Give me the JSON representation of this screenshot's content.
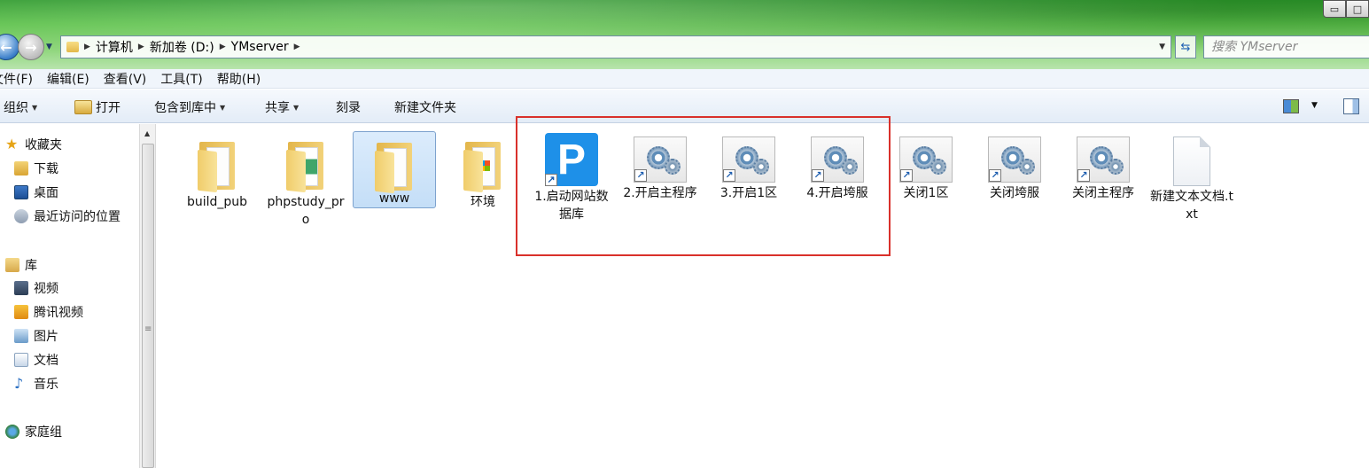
{
  "window": {
    "minimize_icon": "▭",
    "maximize_icon": "□"
  },
  "addressbar": {
    "crumbs": [
      "计算机",
      "新加卷 (D:)",
      "YMserver"
    ],
    "search_placeholder": "搜索 YMserver"
  },
  "menu": {
    "items": [
      "文件(F)",
      "编辑(E)",
      "查看(V)",
      "工具(T)",
      "帮助(H)"
    ]
  },
  "toolbar": {
    "organize": "组织",
    "open": "打开",
    "include_library": "包含到库中",
    "share": "共享",
    "burn": "刻录",
    "new_folder": "新建文件夹"
  },
  "navpane": {
    "favorites": "收藏夹",
    "downloads": "下载",
    "desktop": "桌面",
    "recent": "最近访问的位置",
    "libraries": "库",
    "videos": "视频",
    "tencent_video": "腾讯视频",
    "pictures": "图片",
    "documents": "文档",
    "music": "音乐",
    "homegroup": "家庭组"
  },
  "files": [
    {
      "name": "build_pub",
      "type": "folder"
    },
    {
      "name": "phpstudy_pro",
      "type": "folder"
    },
    {
      "name": "www",
      "type": "folder",
      "selected": true
    },
    {
      "name": "环境",
      "type": "folder"
    },
    {
      "name": "1.启动网站数据库",
      "type": "shortcut-p"
    },
    {
      "name": "2.开启主程序",
      "type": "shortcut-gear"
    },
    {
      "name": "3.开启1区",
      "type": "shortcut-gear"
    },
    {
      "name": "4.开启垮服",
      "type": "shortcut-gear"
    },
    {
      "name": "关闭1区",
      "type": "shortcut-gear"
    },
    {
      "name": "关闭垮服",
      "type": "shortcut-gear"
    },
    {
      "name": "关闭主程序",
      "type": "shortcut-gear"
    },
    {
      "name": "新建文本文档.txt",
      "type": "text"
    }
  ],
  "colors": {
    "highlight_box": "#d9312b",
    "title_green": "#5ec24c",
    "p_icon_blue": "#1e90e8"
  }
}
